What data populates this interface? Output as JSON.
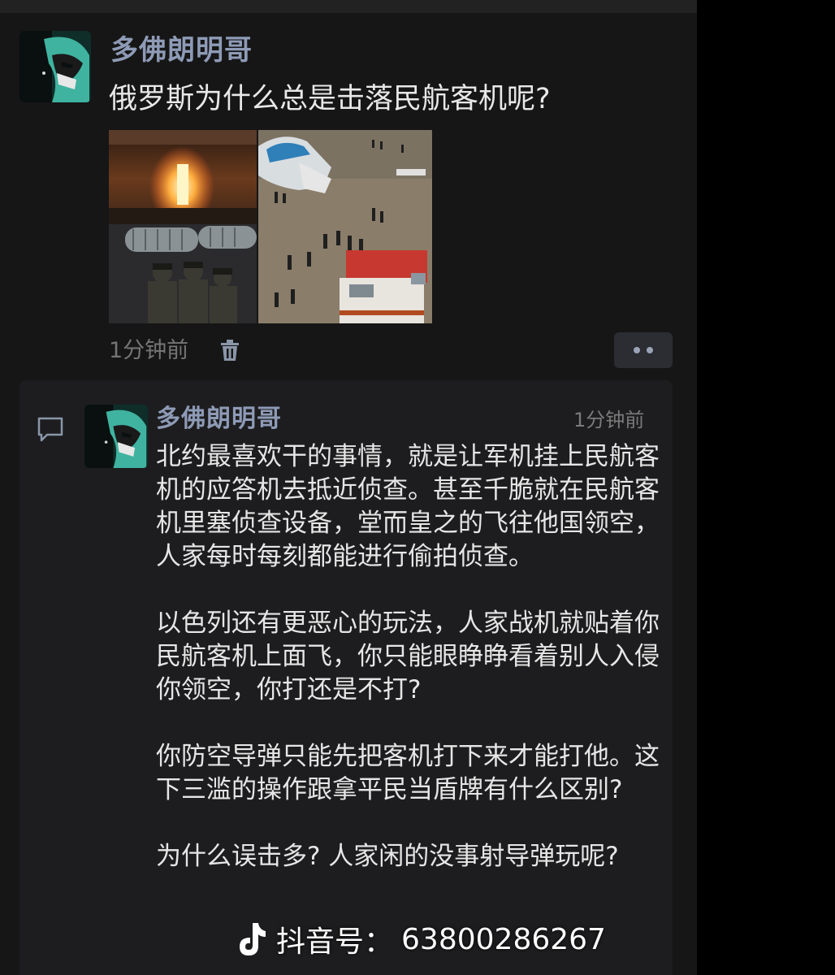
{
  "post": {
    "author": "多佛朗明哥",
    "text": "俄罗斯为什么总是击落民航客机呢?",
    "time": "1分钟前",
    "more_icon": "more-dots-icon",
    "delete_icon": "trash-icon"
  },
  "comment": {
    "author": "多佛朗明哥",
    "time": "1分钟前",
    "paragraphs": [
      "北约最喜欢干的事情，就是让军机挂上民航客机的应答机去抵近侦查。甚至千脆就在民航客机里塞侦查设备，堂而皇之的飞往他国领空，人家每时每刻都能进行偷拍侦查。",
      "以色列还有更恶心的玩法，人家战机就贴着你民航客机上面飞，你只能眼睁睁看着别人入侵你领空，你打还是不打?",
      "你防空导弹只能先把客机打下来才能打他。这下三滥的操作跟拿平民当盾牌有什么区别?",
      "为什么误击多? 人家闲的没事射导弹玩呢?"
    ],
    "comment_icon": "comment-bubble-icon"
  },
  "watermark": {
    "label": "抖音号：",
    "number": "63800286267",
    "logo_icon": "tiktok-logo-icon"
  },
  "colors": {
    "background": "#161616",
    "panel": "#1d1d1f",
    "author": "#8e9bb6",
    "text": "#e8e8e8",
    "muted": "#757575"
  }
}
